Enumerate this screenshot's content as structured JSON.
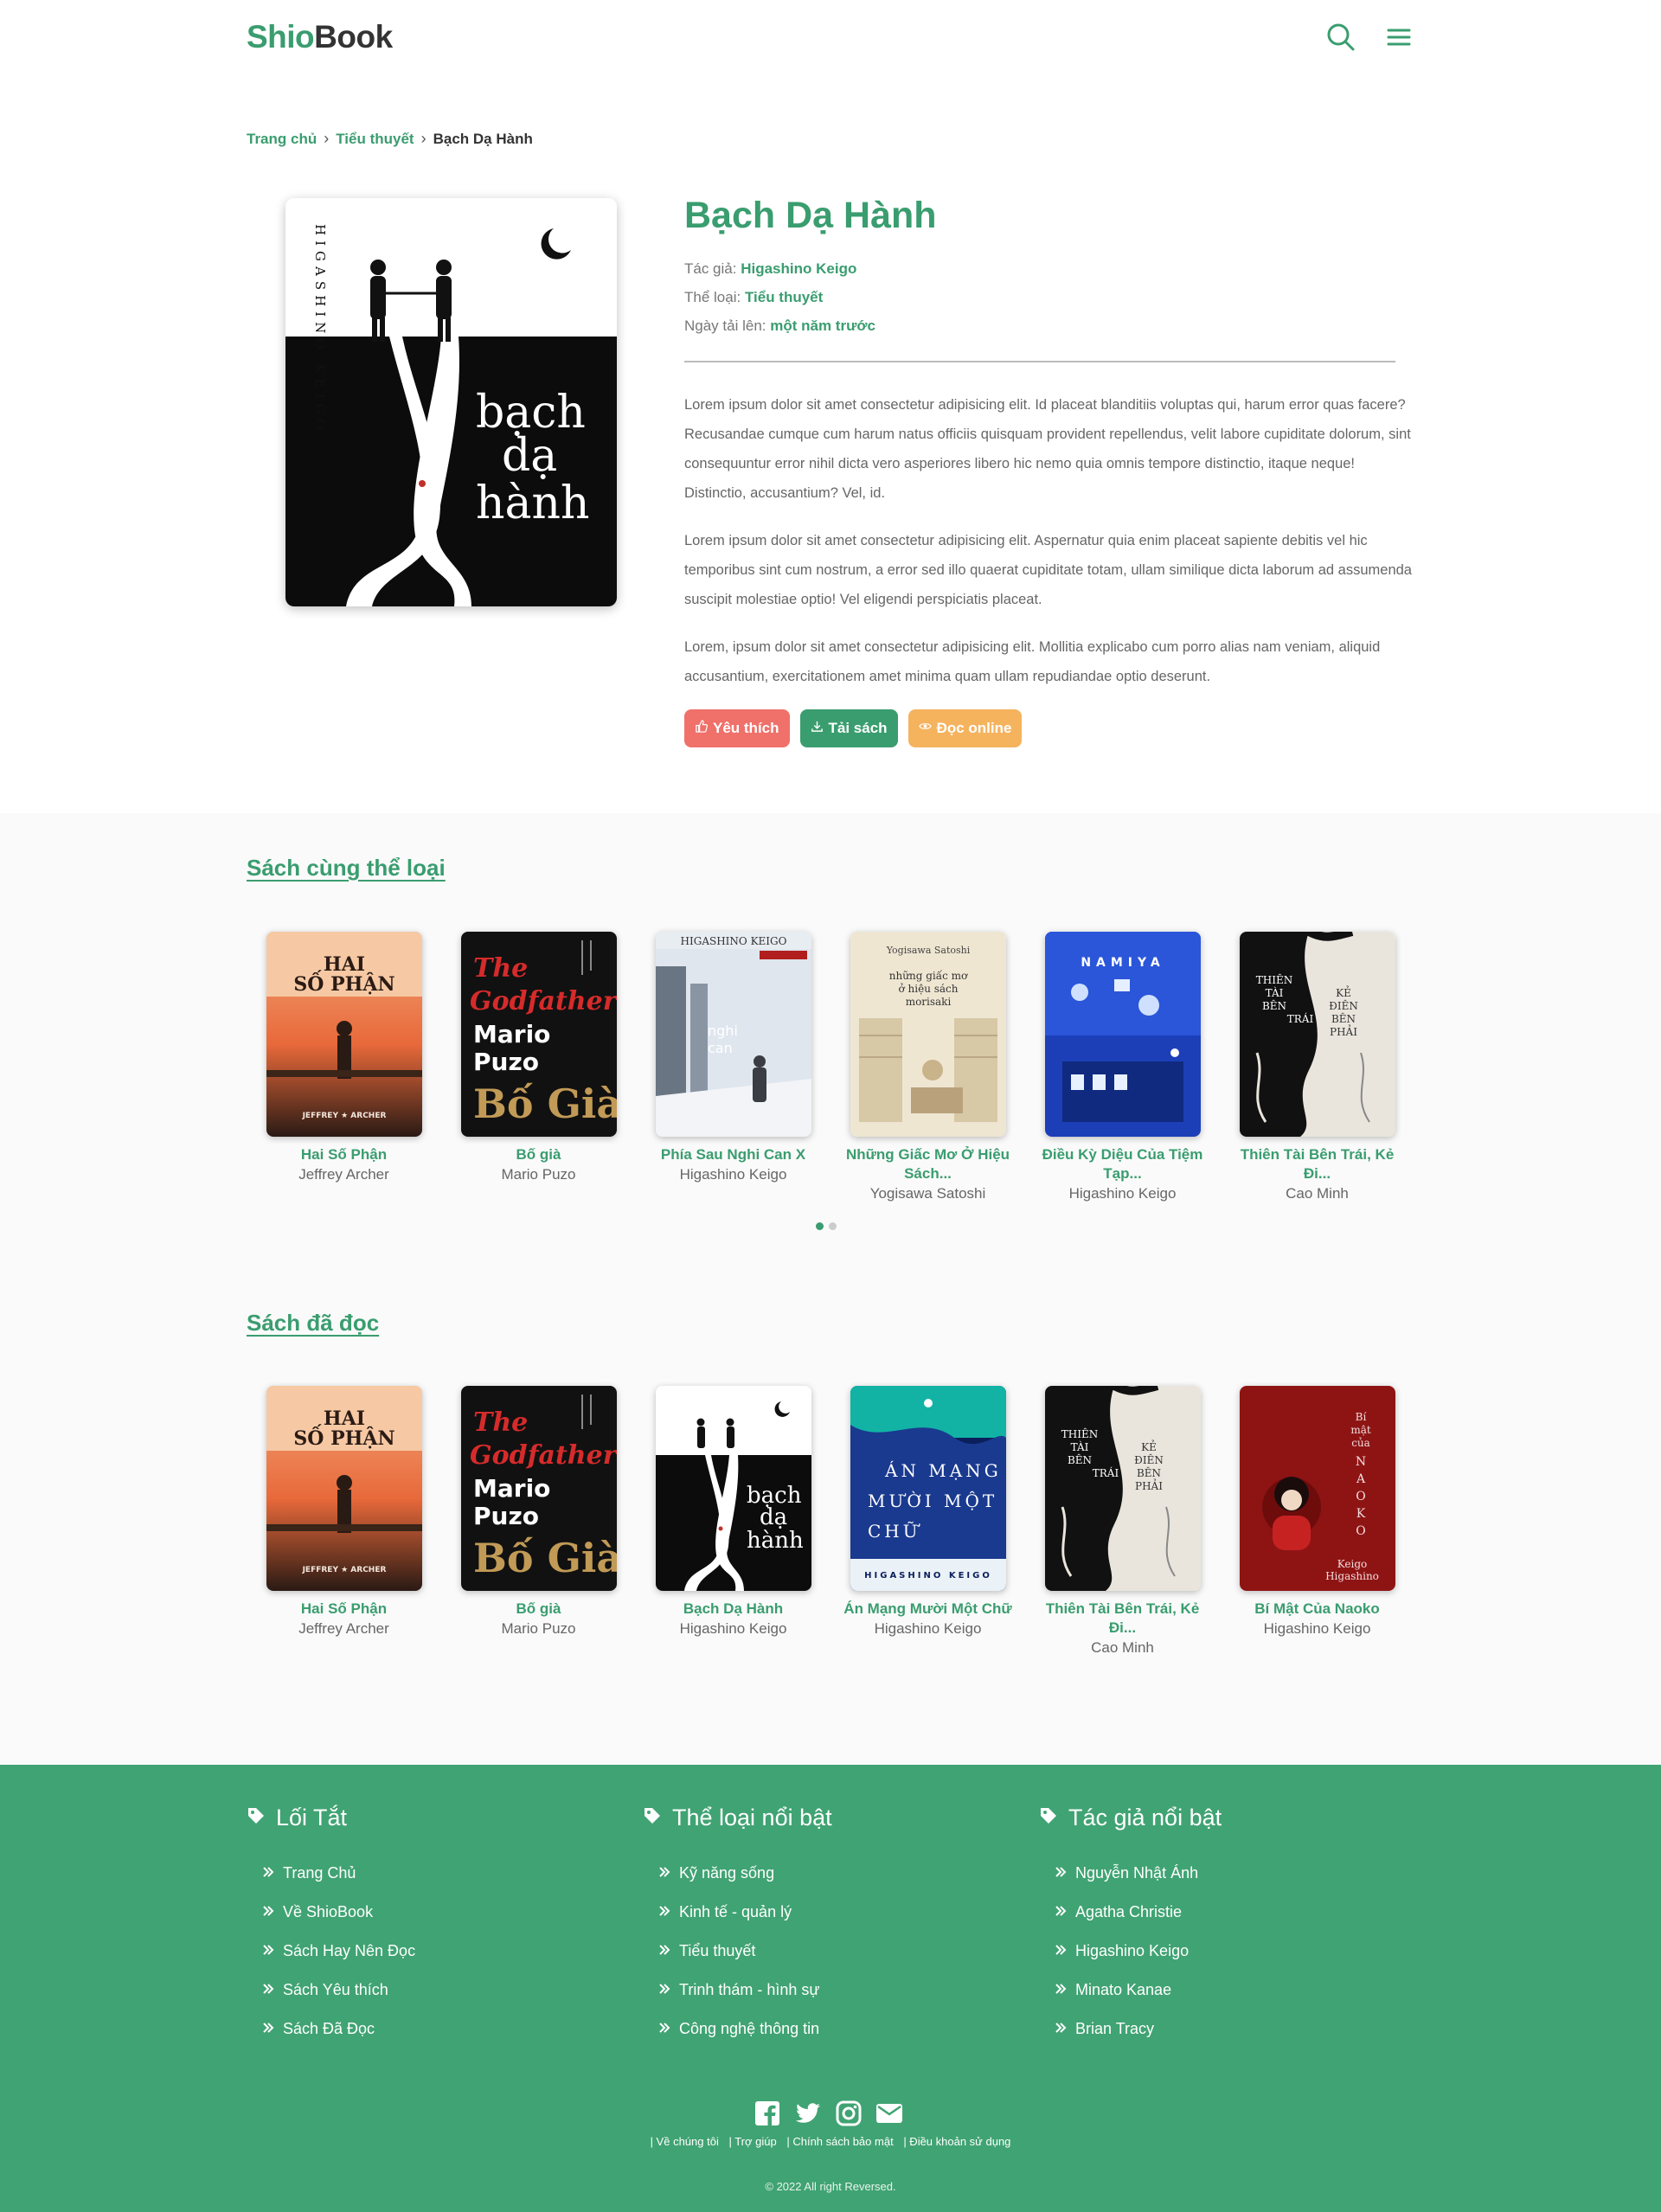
{
  "header": {
    "logo_part1": "Shio",
    "logo_part2": "Book"
  },
  "breadcrumb": {
    "home": "Trang chủ",
    "category": "Tiểu thuyết",
    "current": "Bạch Dạ Hành"
  },
  "book": {
    "title": "Bạch Dạ Hành",
    "author_label": "Tác giả:",
    "author": "Higashino Keigo",
    "category_label": "Thể loại:",
    "category": "Tiểu thuyết",
    "uploaded_label": "Ngày tải lên:",
    "uploaded": "một năm trước",
    "cover_author_vertical": "HIGASHINO KEIGO",
    "cover_title_lines": [
      "bạch",
      "dạ",
      "hành"
    ],
    "description": [
      "Lorem ipsum dolor sit amet consectetur adipisicing elit. Id placeat blanditiis voluptas qui, harum error quas facere? Recusandae cumque cum harum natus officiis quisquam provident repellendus, velit labore cupiditate dolorum, sint consequuntur error nihil dicta vero asperiores libero hic nemo quia omnis tempore distinctio, itaque neque! Distinctio, accusantium? Vel, id.",
      "Lorem ipsum dolor sit amet consectetur adipisicing elit. Aspernatur quia enim placeat sapiente debitis vel hic temporibus sint cum nostrum, a error sed illo quaerat cupiditate totam, ullam similique dicta laborum ad assumenda suscipit molestiae optio! Vel eligendi perspiciatis placeat.",
      "Lorem, ipsum dolor sit amet consectetur adipisicing elit. Mollitia explicabo cum porro alias nam veniam, aliquid accusantium, exercitationem amet minima quam ullam repudiandae optio deserunt."
    ],
    "buttons": {
      "like": "Yêu thích",
      "download": "Tải sách",
      "read": "Đọc online"
    }
  },
  "same_category": {
    "title": "Sách cùng thể loại",
    "books": [
      {
        "title": "Hai Số Phận",
        "author": "Jeffrey Archer",
        "cover": "hai-so-phan"
      },
      {
        "title": "Bố già",
        "author": "Mario Puzo",
        "cover": "bo-gia"
      },
      {
        "title": "Phía Sau Nghi Can X",
        "author": "Higashino Keigo",
        "cover": "nghi-can-x"
      },
      {
        "title": "Những Giấc Mơ Ở Hiệu Sách...",
        "author": "Yogisawa Satoshi",
        "cover": "giac-mo"
      },
      {
        "title": "Điều Kỳ Diệu Của Tiệm Tạp...",
        "author": "Higashino Keigo",
        "cover": "namiya"
      },
      {
        "title": "Thiên Tài Bên Trái, Kẻ Đi...",
        "author": "Cao Minh",
        "cover": "thien-tai"
      }
    ]
  },
  "read_books": {
    "title": "Sách đã đọc",
    "books": [
      {
        "title": "Hai Số Phận",
        "author": "Jeffrey Archer",
        "cover": "hai-so-phan"
      },
      {
        "title": "Bố già",
        "author": "Mario Puzo",
        "cover": "bo-gia"
      },
      {
        "title": "Bạch Dạ Hành",
        "author": "Higashino Keigo",
        "cover": "bach-da-hanh"
      },
      {
        "title": "Án Mạng Mười Một Chữ",
        "author": "Higashino Keigo",
        "cover": "an-mang"
      },
      {
        "title": "Thiên Tài Bên Trái, Kẻ Đi...",
        "author": "Cao Minh",
        "cover": "thien-tai"
      },
      {
        "title": "Bí Mật Của Naoko",
        "author": "Higashino Keigo",
        "cover": "naoko"
      }
    ]
  },
  "footer": {
    "col1": {
      "title": "Lối Tắt",
      "items": [
        "Trang Chủ",
        "Về ShioBook",
        "Sách Hay Nên Đọc",
        "Sách Yêu thích",
        "Sách Đã Đọc"
      ]
    },
    "col2": {
      "title": "Thể loại nổi bật",
      "items": [
        "Kỹ năng sống",
        "Kinh tế - quản lý",
        "Tiểu thuyết",
        "Trinh thám - hình sự",
        "Công nghệ thông tin"
      ]
    },
    "col3": {
      "title": "Tác giả nổi bật",
      "items": [
        "Nguyễn Nhật Ánh",
        "Agatha Christie",
        "Higashino Keigo",
        "Minato Kanae",
        "Brian Tracy"
      ]
    },
    "links": [
      "| Về chúng tôi",
      "| Trợ giúp",
      "| Chính sách bảo mật",
      "| Điều khoản sử dụng"
    ],
    "copyright": "© 2022 All right Reversed."
  },
  "colors": {
    "brand": "#3a9d6f",
    "footer": "#40a373",
    "like": "#f0706a",
    "read": "#f5b35e"
  }
}
